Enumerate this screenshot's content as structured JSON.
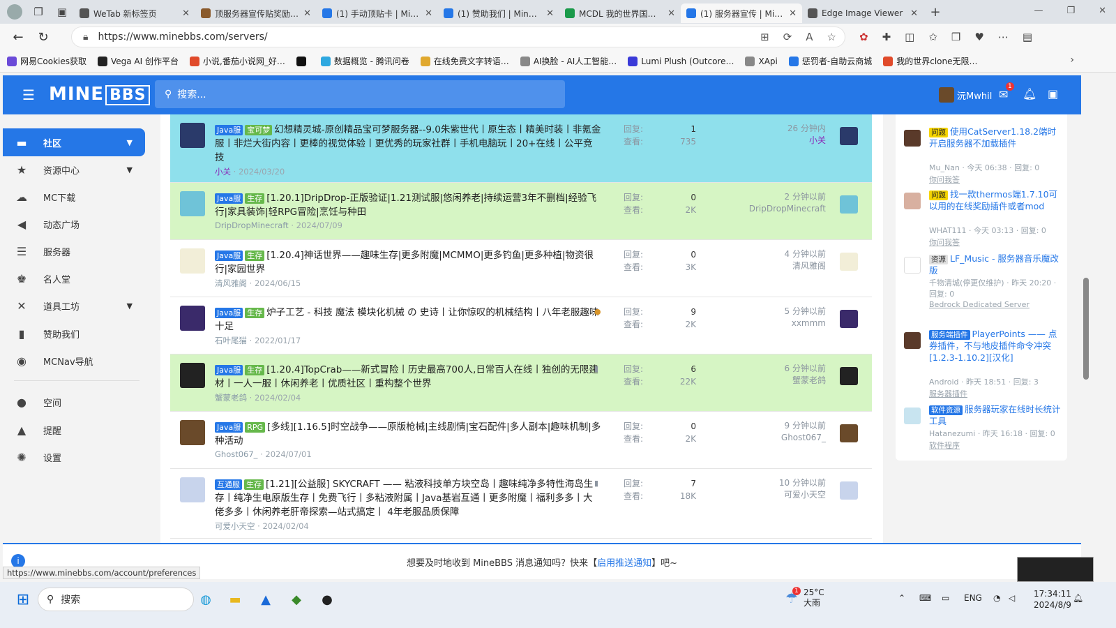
{
  "tabs": [
    {
      "label": "WeTab 新标签页",
      "color": "#555"
    },
    {
      "label": "顶服务器宣传贴奖励…",
      "color": "#8a5a2b"
    },
    {
      "label": "(1) 手动顶贴卡 | Mine…",
      "color": "#2577e7"
    },
    {
      "label": "(1) 赞助我们 | MineBB…",
      "color": "#2577e7"
    },
    {
      "label": "MCDL 我的世界国际版…",
      "color": "#1a9a4a"
    },
    {
      "label": "(1) 服务器宣传 | Mine…",
      "color": "#2577e7"
    },
    {
      "label": "Edge Image Viewer",
      "color": "#555"
    }
  ],
  "url": "https://www.minebbs.com/servers/",
  "bookmarks": [
    {
      "label": "网易Cookies获取",
      "color": "#6b4bd8"
    },
    {
      "label": "Vega AI 创作平台",
      "color": "#222"
    },
    {
      "label": "小说,番茄小说网_好…",
      "color": "#e04a2a"
    },
    {
      "label": "",
      "color": "#111"
    },
    {
      "label": "数据概览 - 腾讯问卷",
      "color": "#2ea8e0"
    },
    {
      "label": "在线免费文字转语…",
      "color": "#e0a82e"
    },
    {
      "label": "AI换脸 - AI人工智能…",
      "color": "#888"
    },
    {
      "label": "Lumi Plush (Outcore…",
      "color": "#3a3ad8"
    },
    {
      "label": "XApi",
      "color": "#888"
    },
    {
      "label": "惩罚者-自助云商城",
      "color": "#2577e7"
    },
    {
      "label": "我的世界clone无限…",
      "color": "#e04a2a"
    }
  ],
  "header": {
    "logo_main": "MINE",
    "logo_box": "BBS",
    "search_placeholder": "搜索...",
    "username": "沅Mwhil",
    "mail_badge": "1"
  },
  "sidebar": {
    "items": [
      {
        "label": "社区",
        "icon": "chat-icon",
        "glyph": "▬",
        "active": true,
        "chevron": true
      },
      {
        "label": "资源中心",
        "icon": "resource-icon",
        "glyph": "★",
        "chevron": true
      },
      {
        "label": "MC下载",
        "icon": "cloud-download-icon",
        "glyph": "☁"
      },
      {
        "label": "动态广场",
        "icon": "megaphone-icon",
        "glyph": "◀"
      },
      {
        "label": "服务器",
        "icon": "server-icon",
        "glyph": "☰"
      },
      {
        "label": "名人堂",
        "icon": "person-icon",
        "glyph": "♚"
      },
      {
        "label": "道具工坊",
        "icon": "tools-icon",
        "glyph": "✕",
        "chevron": true
      },
      {
        "label": "赞助我们",
        "icon": "donate-icon",
        "glyph": "▮"
      },
      {
        "label": "MCNav导航",
        "icon": "compass-icon",
        "glyph": "◉"
      },
      {
        "label": "空间",
        "icon": "user-icon",
        "glyph": "●"
      },
      {
        "label": "提醒",
        "icon": "bell-icon",
        "glyph": "▲"
      },
      {
        "label": "设置",
        "icon": "settings-icon",
        "glyph": "✺"
      }
    ]
  },
  "threads": [
    {
      "tags": [
        {
          "t": "Java服",
          "c": "java"
        },
        {
          "t": "宝可梦",
          "c": "bao"
        }
      ],
      "title": "幻想精灵城-原创精品宝可梦服务器--9.0朱紫世代丨原生态丨精美时装丨非氪金服丨非烂大街内容丨更棒的视觉体验丨更优秀的玩家社群丨手机电脑玩丨20+在线丨公平竞技",
      "author": "小关",
      "date": "2024/03/20",
      "replies": "1",
      "views": "735",
      "last_time": "26 分钟内",
      "last_user": "小关",
      "bg": "#8fe0ec",
      "av": "#2a3a6a"
    },
    {
      "tags": [
        {
          "t": "Java服",
          "c": "java"
        },
        {
          "t": "生存",
          "c": "survive"
        }
      ],
      "title": "[1.20.1]DripDrop-正版验证|1.21测试服|悠闲养老|持续运营3年不删档|经验飞行|家具装饰|轻RPG冒险|烹饪与种田",
      "author": "DripDropMinecraft",
      "date": "2024/07/09",
      "replies": "0",
      "views": "2K",
      "last_time": "2 分钟以前",
      "last_user": "DripDropMinecraft",
      "bg": "#d6f5c4",
      "av": "#6fc3d8"
    },
    {
      "tags": [
        {
          "t": "Java服",
          "c": "java"
        },
        {
          "t": "生存",
          "c": "survive"
        }
      ],
      "title": "[1.20.4]神话世界——趣味生存|更多附魔|MCMMO|更多钓鱼|更多种植|物资很行|家园世界",
      "author": "清风雅阁",
      "date": "2024/06/15",
      "replies": "0",
      "views": "3K",
      "last_time": "4 分钟以前",
      "last_user": "清风雅阁",
      "bg": "#ffffff",
      "av": "#f2eed8"
    },
    {
      "tags": [
        {
          "t": "Java服",
          "c": "java"
        },
        {
          "t": "生存",
          "c": "survive"
        }
      ],
      "title": "炉子工艺 - 科技 魔法 模块化机械 の 史诗丨让你惊叹的机械结构丨八年老服趣味十足",
      "author": "石叶尾猫",
      "date": "2022/01/17",
      "replies": "9",
      "views": "2K",
      "last_time": "5 分钟以前",
      "last_user": "xxmmm",
      "bg": "#ffffff",
      "av": "#3a2a6a"
    },
    {
      "tags": [
        {
          "t": "Java服",
          "c": "java"
        },
        {
          "t": "生存",
          "c": "survive"
        }
      ],
      "title": "[1.20.4]TopCrab——新式冒险丨历史最高700人,日常百人在线丨独创的无限建材丨一人一服丨休闲养老丨优质社区丨重构整个世界",
      "author": "蟹蒙老鸽",
      "date": "2024/02/04",
      "replies": "6",
      "views": "22K",
      "last_time": "6 分钟以前",
      "last_user": "蟹蒙老鸽",
      "bg": "#d6f5c4",
      "av": "#222"
    },
    {
      "tags": [
        {
          "t": "Java服",
          "c": "java"
        },
        {
          "t": "RPG",
          "c": "rpg"
        }
      ],
      "title": "[多线][1.16.5]时空战争——原版枪械|主线剧情|宝石配件|多人副本|趣味机制|多种活动",
      "author": "Ghost067_",
      "date": "2024/07/01",
      "replies": "0",
      "views": "2K",
      "last_time": "9 分钟以前",
      "last_user": "Ghost067_",
      "bg": "#ffffff",
      "av": "#6a4a2a"
    },
    {
      "tags": [
        {
          "t": "互通服",
          "c": "hu"
        },
        {
          "t": "生存",
          "c": "survive"
        }
      ],
      "title": "[1.21][公益服] SKYCRAFT —— 粘液科技单方块空岛丨趣味纯净多特性海岛生存丨纯净生电原版生存丨免费飞行丨多粘液附属丨Java基岩互通丨更多附魔丨福利多多丨大佬多多丨休闲养老肝帝探索—站式搞定丨 4年老服品质保障",
      "author": "可爱小天空",
      "date": "2024/02/04",
      "replies": "7",
      "views": "18K",
      "last_time": "10 分钟以前",
      "last_user": "可爱小天空",
      "bg": "#ffffff",
      "av": "#c8d4ec"
    }
  ],
  "stat_labels": {
    "replies": "回复:",
    "views": "查看:"
  },
  "right_side": [
    {
      "tag": "问题",
      "tag_bg": "#f5d400",
      "tag_fg": "#222",
      "title": "使用CatServer1.18.2端时开启服务器不加载插件",
      "meta": "Mu_Nan · 今天 06:38 · 回复: 0",
      "cat": "你问我答",
      "av": "#5a3a2a"
    },
    {
      "tag": "问题",
      "tag_bg": "#f5d400",
      "tag_fg": "#222",
      "title": "找一款thermos端1.7.10可以用的在线奖励插件或者mod",
      "meta": "WHAT111 · 今天 03:13 · 回复: 0",
      "cat": "你问我答",
      "av": "#d8b0a0"
    },
    {
      "tag": "资源",
      "tag_bg": "#e0e0e0",
      "tag_fg": "#333",
      "title": "LF_Music - 服务器音乐魔改版",
      "meta": "千物清城(停更仅维护) · 昨天 20:20 · 回复: 0",
      "cat": "Bedrock Dedicated Server",
      "av": "#ffffff"
    },
    {
      "tag": "服务端插件",
      "tag_bg": "#2577e7",
      "tag_fg": "#fff",
      "title": "PlayerPoints —— 点券插件，不与地皮插件命令冲突[1.2.3-1.10.2][汉化]",
      "meta": "Android · 昨天 18:51 · 回复: 3",
      "cat": "服务器插件",
      "av": "#5a3a2a"
    },
    {
      "tag": "软件资源",
      "tag_bg": "#2577e7",
      "tag_fg": "#fff",
      "title": "服务器玩家在线时长统计工具",
      "meta": "Hatanezumi · 昨天 16:18 · 回复: 0",
      "cat": "软件程序",
      "av": "#c8e4f0"
    }
  ],
  "notify": {
    "pre": "想要及时地收到 MineBBS 消息通知吗？快来【",
    "link": "启用推送通知",
    "post": "】吧~"
  },
  "status_url": "https://www.minebbs.com/account/preferences",
  "taskbar": {
    "search": "搜索",
    "weather_temp": "25°C",
    "weather_desc": "大雨",
    "weather_badge": "1",
    "lang": "ENG",
    "time": "17:34:11",
    "date": "2024/8/9"
  }
}
